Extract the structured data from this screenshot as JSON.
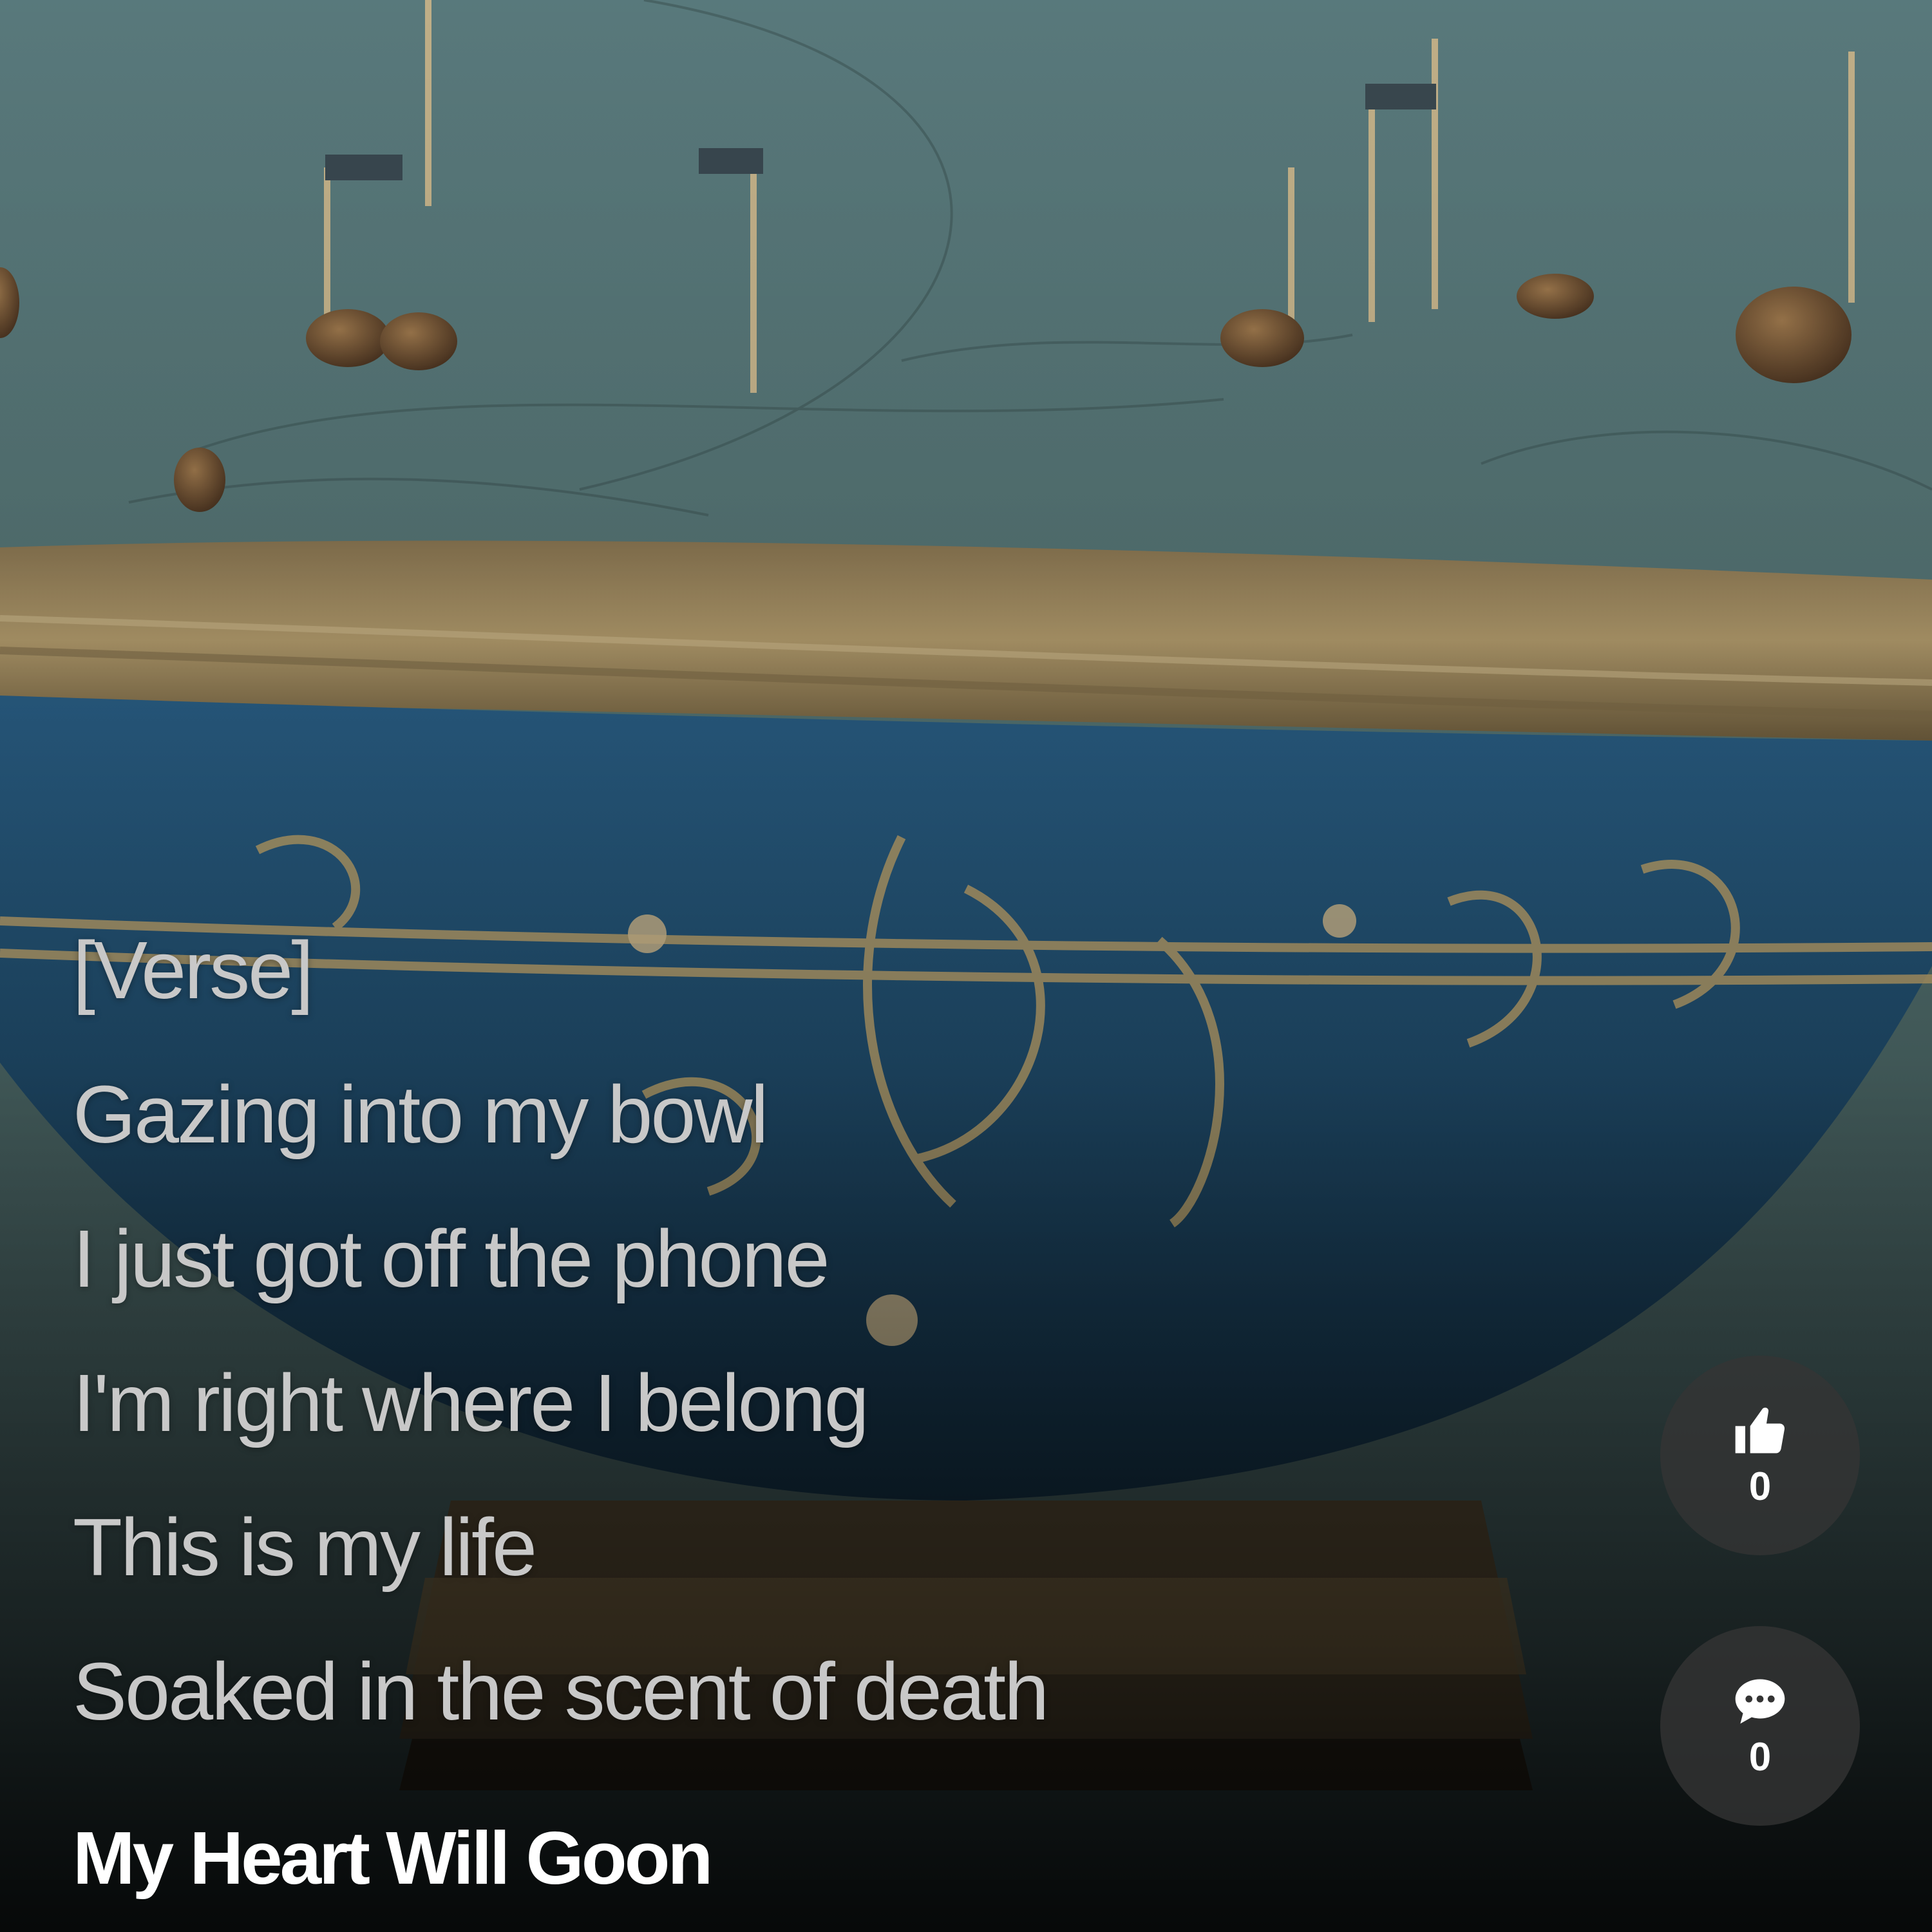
{
  "lyrics": {
    "lines": [
      "[Verse]",
      "Gazing into my bowl",
      "I just got off the phone",
      "I'm right where I belong",
      "This is my life",
      "Soaked in the scent of death"
    ]
  },
  "song": {
    "title": "My Heart Will Goon"
  },
  "actions": {
    "like": {
      "icon": "thumbs-up-icon",
      "count": "0"
    },
    "comment": {
      "icon": "comment-bubble-icon",
      "count": "0"
    }
  },
  "colors": {
    "lyric_text": "#c8c8c8",
    "title_text": "#ffffff",
    "button_bg": "#343434",
    "background": "#3f5a5e",
    "bowl_blue": "#1d4a6a",
    "bowl_gold": "#a8905c"
  }
}
